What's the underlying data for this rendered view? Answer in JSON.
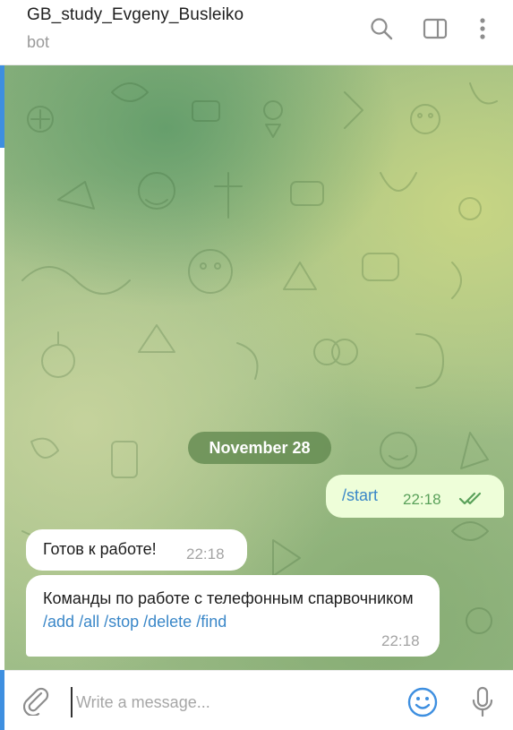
{
  "header": {
    "title": "GB_study_Evgeny_Busleiko",
    "subtitle": "bot",
    "icons": [
      "search-icon",
      "sidebar-toggle-icon",
      "more-vertical-icon"
    ]
  },
  "chat": {
    "date_label": "November 28",
    "messages": [
      {
        "direction": "outgoing",
        "text": "/start",
        "time": "22:18",
        "status": "read"
      },
      {
        "direction": "incoming",
        "text": "Готов к работе!",
        "time": "22:18"
      },
      {
        "direction": "incoming",
        "text_prefix": "Команды по работе с телефонным спарвочником",
        "commands": [
          "/add",
          "/all",
          "/stop",
          "/delete",
          "/find"
        ],
        "time": "22:18"
      }
    ]
  },
  "composer": {
    "placeholder": "Write a message...",
    "icons": [
      "paperclip-icon",
      "emoji-icon",
      "microphone-icon"
    ]
  },
  "colors": {
    "accent": "#3e8fe0",
    "link": "#3a87c8",
    "outgoing_bubble": "#eefed9",
    "read_check": "#5aa15a",
    "date_pill": "#60884e"
  }
}
